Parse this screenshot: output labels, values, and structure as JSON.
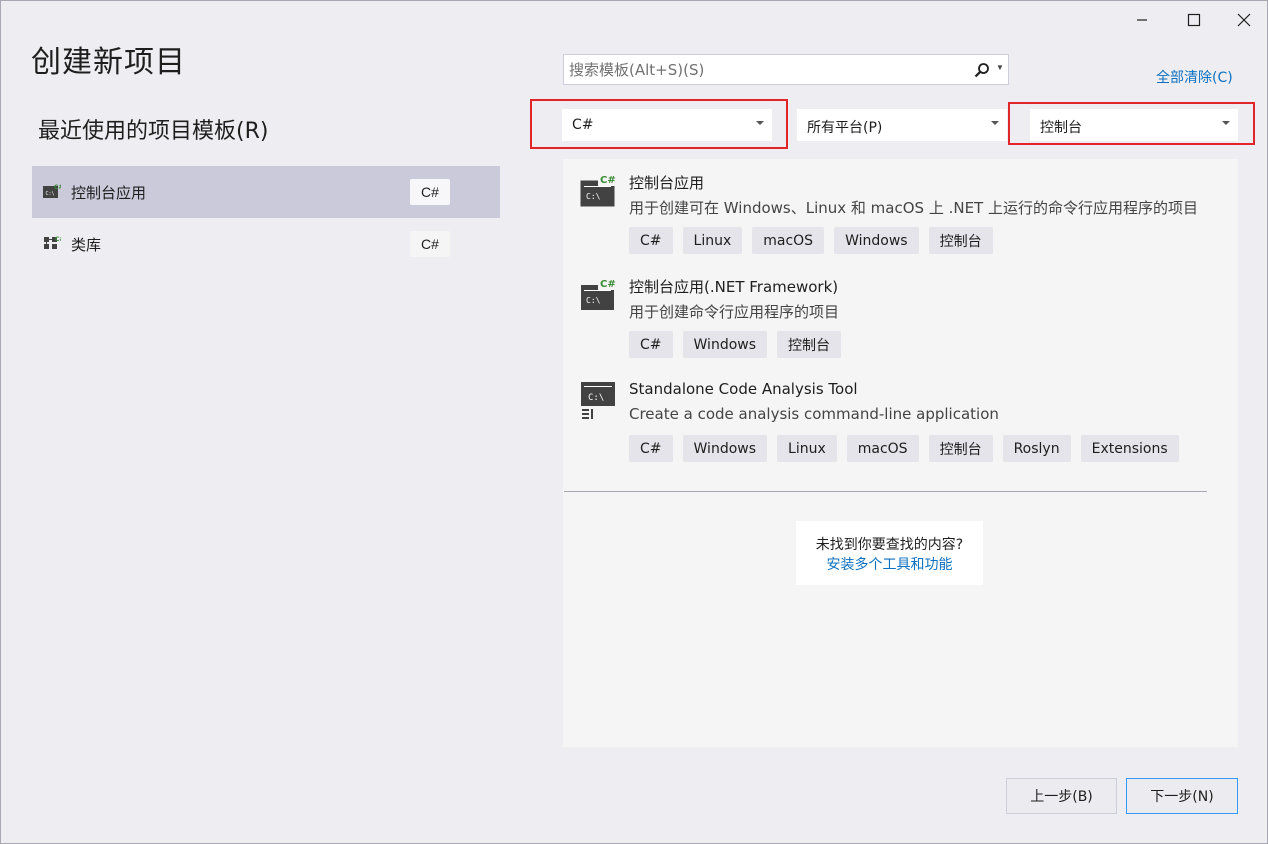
{
  "window": {
    "minimize_icon": "minimize-icon",
    "maximize_icon": "maximize-icon",
    "close_icon": "close-icon"
  },
  "page_title": "创建新项目",
  "recent": {
    "title": "最近使用的项目模板(R)",
    "items": [
      {
        "label": "控制台应用",
        "badge": "C#",
        "icon": "console-app-icon",
        "selected": true
      },
      {
        "label": "类库",
        "badge": "C#",
        "icon": "class-library-icon",
        "selected": false
      }
    ]
  },
  "search": {
    "placeholder": "搜索模板(Alt+S)(S)",
    "icon": "search-icon"
  },
  "clear_all": "全部清除(C)",
  "filters": {
    "language": "C#",
    "platform": "所有平台(P)",
    "project_type": "控制台"
  },
  "templates": [
    {
      "name": "控制台应用",
      "description": "用于创建可在 Windows、Linux 和 macOS 上 .NET 上运行的命令行应用程序的项目",
      "tags": [
        "C#",
        "Linux",
        "macOS",
        "Windows",
        "控制台"
      ],
      "icon": "console-csharp-icon"
    },
    {
      "name": "控制台应用(.NET Framework)",
      "description": "用于创建命令行应用程序的项目",
      "tags": [
        "C#",
        "Windows",
        "控制台"
      ],
      "icon": "console-csharp-icon"
    },
    {
      "name": "Standalone Code Analysis Tool",
      "description": "Create a code analysis command-line application",
      "tags": [
        "C#",
        "Windows",
        "Linux",
        "macOS",
        "控制台",
        "Roslyn",
        "Extensions"
      ],
      "icon": "code-analysis-icon"
    }
  ],
  "not_found": {
    "text": "未找到你要查找的内容?",
    "link": "安装多个工具和功能"
  },
  "buttons": {
    "back": "上一步(B)",
    "next": "下一步(N)"
  },
  "colors": {
    "background": "#EEEEF2",
    "accent_link": "#0E70C0",
    "highlight_box": "#E2242B",
    "selected_row": "#CACADA",
    "csharp_green": "#388A34"
  }
}
